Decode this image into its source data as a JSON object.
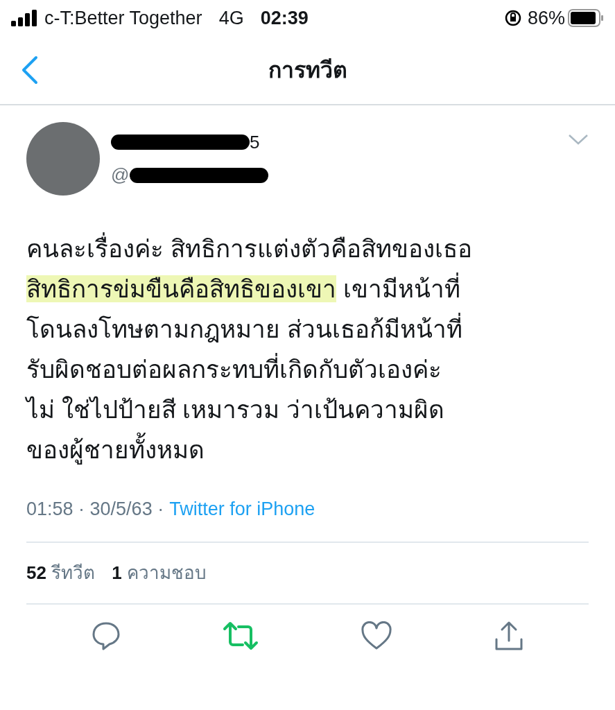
{
  "status_bar": {
    "carrier": "c-T:Better Together",
    "network": "4G",
    "time": "02:39",
    "battery": "86%"
  },
  "nav": {
    "title": "การทวีต"
  },
  "author": {
    "name_visible": "5",
    "handle_visible": "@"
  },
  "tweet": {
    "lines": [
      [
        {
          "text": "คนละเรื่องค่ะ สิทธิการแต่งตัวคือสิทของเธอ",
          "highlighted": false
        }
      ],
      [
        {
          "text": "สิทธิการข่มขืนคือสิทธิของเขา",
          "highlighted": true
        },
        {
          "text": " เขามีหน้าที่",
          "highlighted": false
        }
      ],
      [
        {
          "text": "โดนลงโทษตามกฎหมาย ส่วนเธอก้มีหน้าที่",
          "highlighted": false
        }
      ],
      [
        {
          "text": "รับผิดชอบต่อผลกระทบที่เกิดกับตัวเองค่ะ",
          "highlighted": false
        }
      ],
      [
        {
          "text": "ไม่ ใช่ไปป้ายสี เหมารวม ว่าเป้นความผิด",
          "highlighted": false
        }
      ],
      [
        {
          "text": "ของผู้ชายทั้งหมด",
          "highlighted": false
        }
      ]
    ],
    "time": "01:58 · 30/5/63 ·",
    "source": "Twitter for iPhone"
  },
  "stats": [
    {
      "count": "52",
      "label": "รีทวีต"
    },
    {
      "count": "1",
      "label": "ความชอบ"
    }
  ],
  "actions": {
    "retweeted": true,
    "liked": false
  }
}
